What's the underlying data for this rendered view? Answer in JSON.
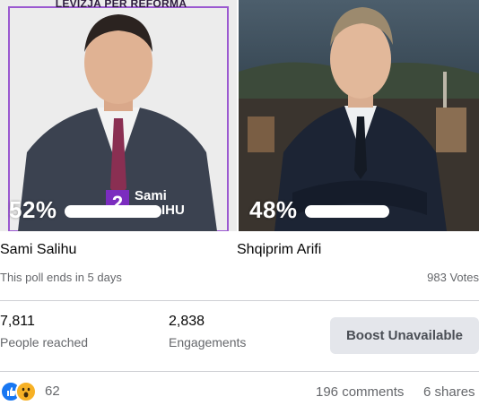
{
  "poll": {
    "left_option": {
      "name": "Sami Salihu",
      "percent": "52%",
      "percent_value": 52,
      "banner_text": "LEVIZJA PER REFORMA",
      "tag_number": "2",
      "tag_first": "Sami",
      "tag_last": "SALIHU"
    },
    "right_option": {
      "name": "Shqiprim Arifi",
      "percent": "48%",
      "percent_value": 48
    },
    "ends_text": "This poll ends in 5 days",
    "votes_text": "983 Votes"
  },
  "insights": {
    "reach_value": "7,811",
    "reach_label": "People reached",
    "engagement_value": "2,838",
    "engagement_label": "Engagements",
    "boost_label": "Boost Unavailable"
  },
  "footer": {
    "reaction_count": "62",
    "comments": "196 comments",
    "shares": "6 shares",
    "reaction_icons": [
      "like-icon",
      "wow-icon"
    ]
  },
  "colors": {
    "accent_purple": "#7b2cbf",
    "like_blue": "#1877f2",
    "wow_yellow": "#f7b125",
    "button_bg": "#e4e6eb",
    "muted_text": "#65676b"
  }
}
